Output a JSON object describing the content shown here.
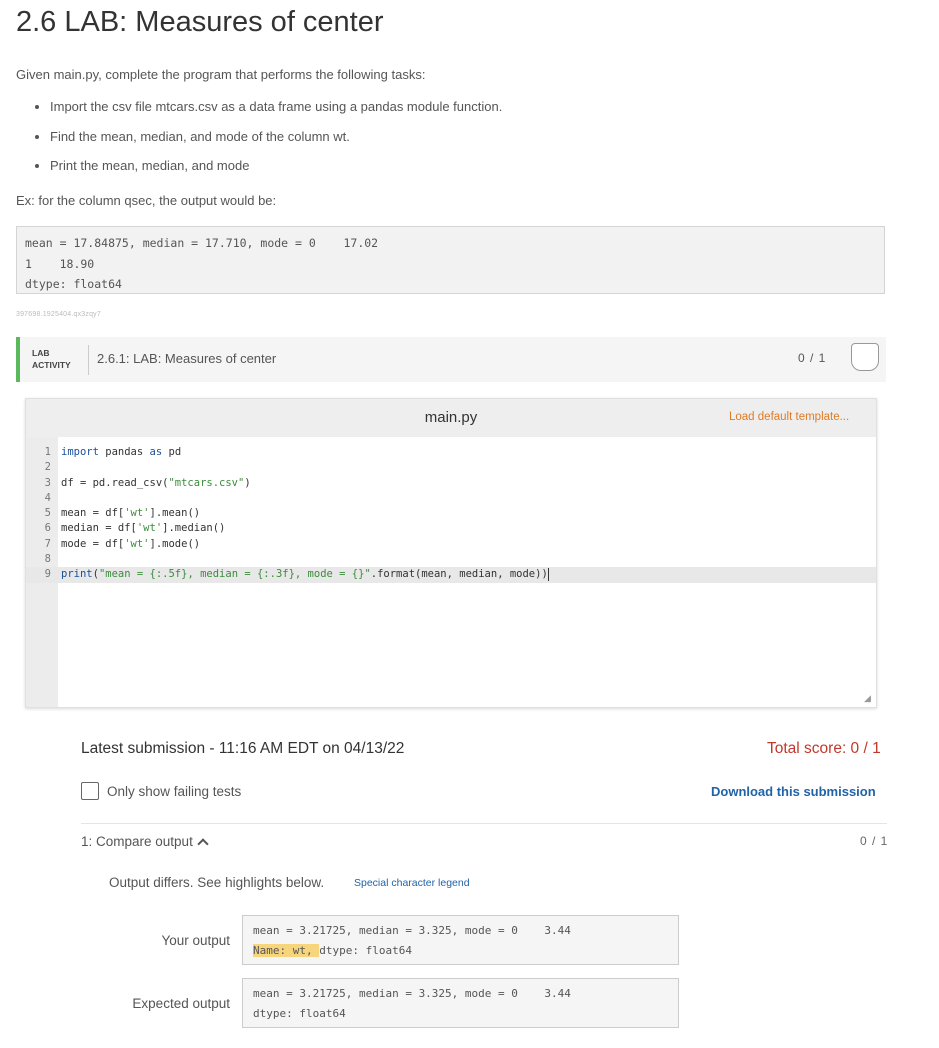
{
  "page": {
    "title": "2.6 LAB: Measures of center",
    "intro": "Given main.py, complete the program that performs the following tasks:",
    "tasks": [
      "Import the csv file mtcars.csv as a data frame using a pandas module function.",
      "Find the mean, median, and mode of the column wt.",
      "Print the mean, median, and mode"
    ],
    "example_label": "Ex: for the column qsec, the output would be:",
    "example_output": [
      "mean = 17.84875, median = 17.710, mode = 0    17.02",
      "1    18.90",
      "dtype: float64"
    ],
    "watermark": "397698.1925404.qx3zqy7"
  },
  "lab": {
    "tag_line1": "LAB",
    "tag_line2": "ACTIVITY",
    "name": "2.6.1: LAB: Measures of center",
    "score": "0 / 1"
  },
  "editor": {
    "filename": "main.py",
    "load_template": "Load default template...",
    "lines": [
      {
        "n": "1",
        "a": "import",
        "b": " pandas ",
        "c": "as",
        "d": " pd",
        "e": ""
      },
      {
        "n": "2",
        "a": "",
        "b": "",
        "c": "",
        "d": "",
        "e": ""
      },
      {
        "n": "3",
        "a": "",
        "b": "df = pd.read_csv(",
        "c": "\"mtcars.csv\"",
        "d": ")",
        "e": ""
      },
      {
        "n": "4",
        "a": "",
        "b": "",
        "c": "",
        "d": "",
        "e": ""
      },
      {
        "n": "5",
        "a": "",
        "b": "mean = df[",
        "c": "'wt'",
        "d": "].mean()",
        "e": ""
      },
      {
        "n": "6",
        "a": "",
        "b": "median = df[",
        "c": "'wt'",
        "d": "].median()",
        "e": ""
      },
      {
        "n": "7",
        "a": "",
        "b": "mode = df[",
        "c": "'wt'",
        "d": "].mode()",
        "e": ""
      },
      {
        "n": "8",
        "a": "",
        "b": "",
        "c": "",
        "d": "",
        "e": ""
      },
      {
        "n": "9",
        "a": "print",
        "b": "(",
        "c": "\"mean = {:.5f}, median = {:.3f}, mode = {}\"",
        "d": ".format(mean, median, mode))",
        "e": ""
      }
    ]
  },
  "submission": {
    "latest": "Latest submission - 11:16 AM EDT on 04/13/22",
    "total_score": "Total score: 0 / 1",
    "only_failing": "Only show failing tests",
    "download": "Download this submission",
    "test_title": "1: Compare output",
    "test_score": "0 / 1",
    "output_differs": "Output differs. See highlights below.",
    "special_legend": "Special character legend",
    "your_output_label": "Your output",
    "your_output_line1": "mean = 3.21725, median = 3.325, mode = 0    3.44",
    "your_output_line2_hl": "Name: wt, ",
    "your_output_line2_rest": "dtype: float64",
    "expected_output_label": "Expected output",
    "expected_output_line1": "mean = 3.21725, median = 3.325, mode = 0    3.44",
    "expected_output_line2": "dtype: float64"
  }
}
